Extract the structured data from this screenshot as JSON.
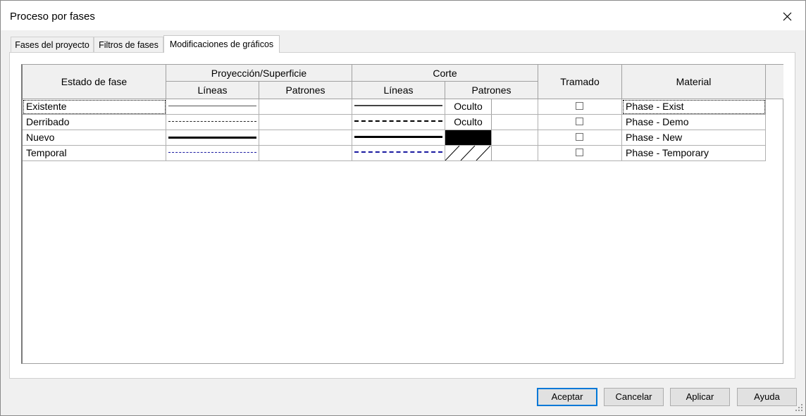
{
  "window": {
    "title": "Proceso por fases"
  },
  "tabs": [
    {
      "label": "Fases del proyecto"
    },
    {
      "label": "Filtros de fases"
    },
    {
      "label": "Modificaciones de gráficos"
    }
  ],
  "table": {
    "headers": {
      "estado": "Estado de fase",
      "proyeccion": "Proyección/Superficie",
      "corte": "Corte",
      "tramado": "Tramado",
      "material": "Material",
      "lineas": "Líneas",
      "patrones": "Patrones"
    },
    "rows": [
      {
        "name": "Existente",
        "cut_pattern": "Oculto",
        "tramado": false,
        "material": "Phase - Exist",
        "proj_line": "thin-solid",
        "cut_line": "medium-solid",
        "cut_fill": "text"
      },
      {
        "name": "Derribado",
        "cut_pattern": "Oculto",
        "tramado": false,
        "material": "Phase - Demo",
        "proj_line": "thin-dashed",
        "cut_line": "bold-dashed",
        "cut_fill": "text"
      },
      {
        "name": "Nuevo",
        "cut_pattern": "",
        "tramado": false,
        "material": "Phase - New",
        "proj_line": "bold-solid",
        "cut_line": "bold-solid",
        "cut_fill": "solid-black"
      },
      {
        "name": "Temporal",
        "cut_pattern": "",
        "tramado": false,
        "material": "Phase - Temporary",
        "proj_line": "blue-dashed",
        "cut_line": "blue-dashed-bold",
        "cut_fill": "diagonal-hatch"
      }
    ]
  },
  "buttons": {
    "accept": "Aceptar",
    "cancel": "Cancelar",
    "apply": "Aplicar",
    "help": "Ayuda"
  },
  "colors": {
    "accent": "#0078d7",
    "temporary_line": "#1a1aa0"
  }
}
